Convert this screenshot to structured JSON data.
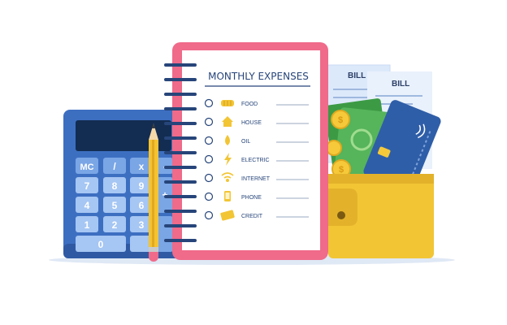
{
  "notepad": {
    "title": "MONTHLY EXPENSES",
    "items": [
      {
        "label": "FOOD",
        "icon": "food-icon"
      },
      {
        "label": "HOUSE",
        "icon": "house-icon"
      },
      {
        "label": "OIL",
        "icon": "oil-drop-icon"
      },
      {
        "label": "ELECTRIC",
        "icon": "lightning-icon"
      },
      {
        "label": "INTERNET",
        "icon": "wifi-icon"
      },
      {
        "label": "PHONE",
        "icon": "phone-icon"
      },
      {
        "label": "CREDIT",
        "icon": "credit-card-icon"
      }
    ]
  },
  "calculator": {
    "keys": [
      "MC",
      "/",
      "x",
      "-",
      "7",
      "8",
      "9",
      "+",
      "4",
      "5",
      "6",
      "1",
      "2",
      "3",
      "0"
    ]
  },
  "bills": {
    "bill_a": "BILL",
    "bill_b": "BILL"
  },
  "colors": {
    "calculator": "#3d6fc1",
    "notepad_frame": "#f06a8a",
    "wallet": "#f2c535",
    "card": "#2f5ea8",
    "money": "#3c9a45",
    "coin": "#f5c93a"
  }
}
